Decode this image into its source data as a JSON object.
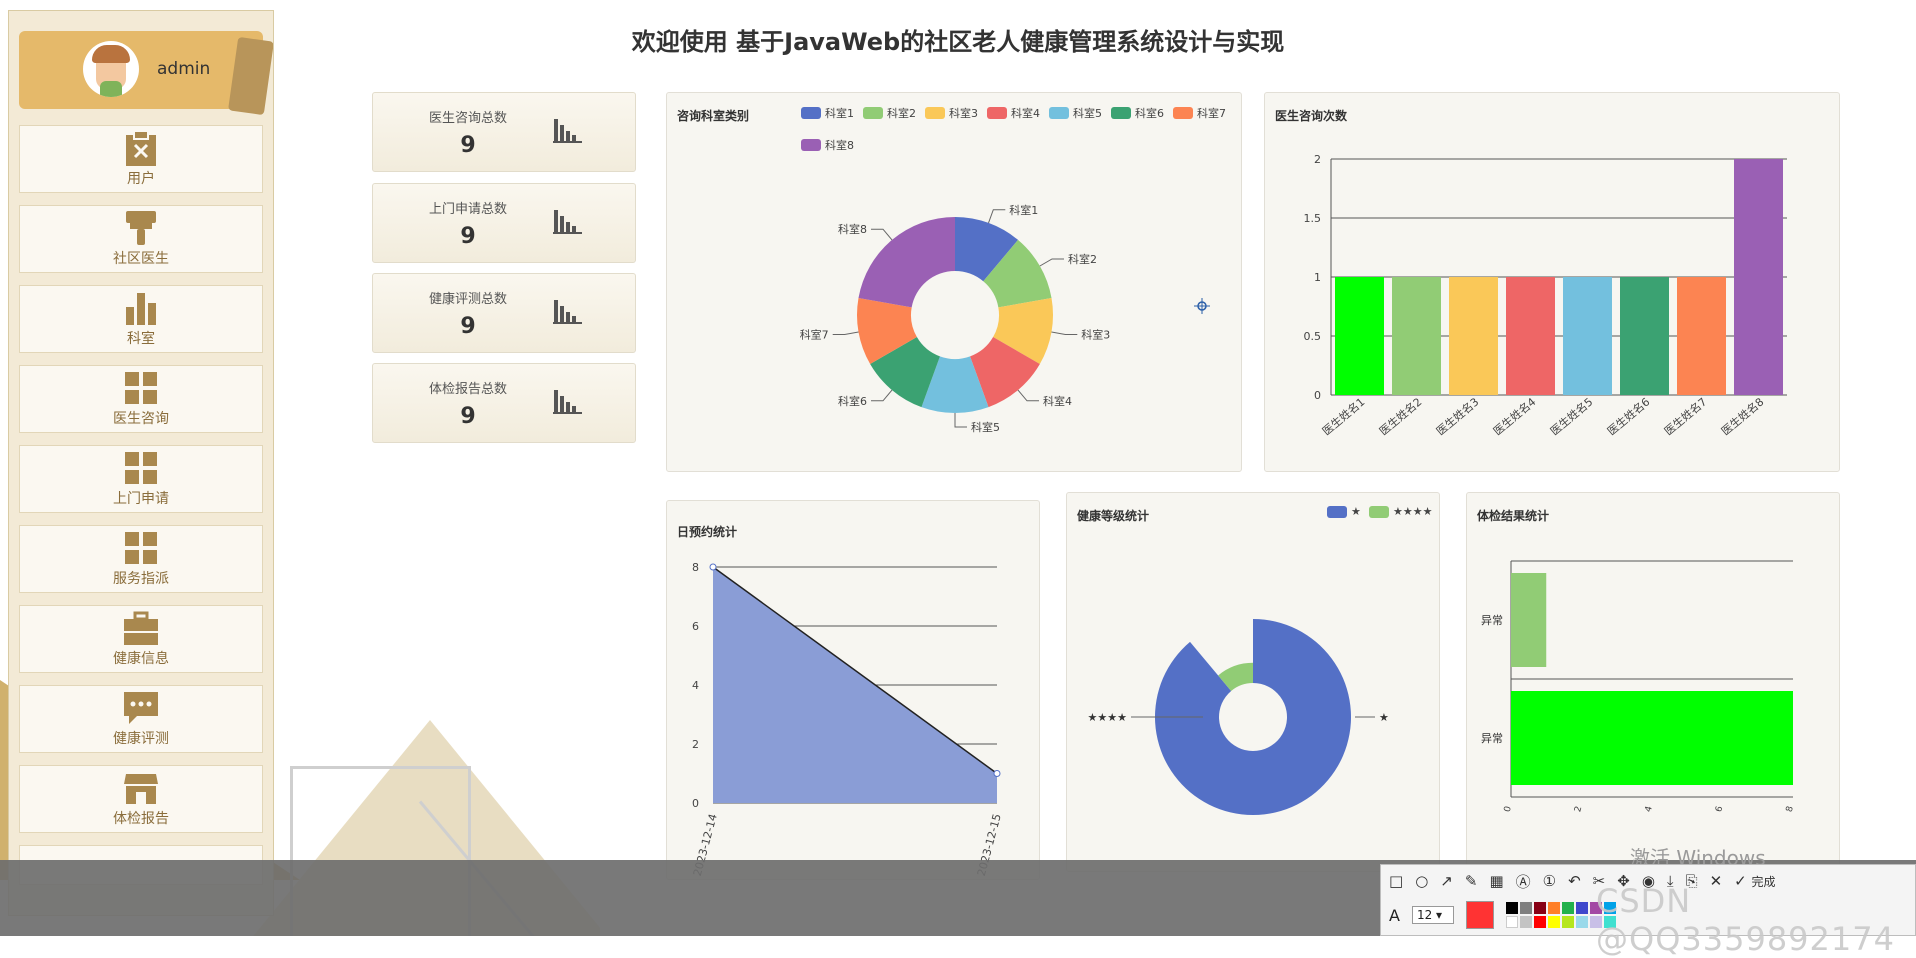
{
  "header": {
    "title": "欢迎使用 基于JavaWeb的社区老人健康管理系统设计与实现"
  },
  "user": {
    "name": "admin"
  },
  "sidebar": {
    "items": [
      {
        "label": "用户",
        "icon": "clipboard-x-icon"
      },
      {
        "label": "社区医生",
        "icon": "paint-roller-icon"
      },
      {
        "label": "科室",
        "icon": "bar-chart-icon"
      },
      {
        "label": "医生咨询",
        "icon": "grid-icon"
      },
      {
        "label": "上门申请",
        "icon": "grid-icon"
      },
      {
        "label": "服务指派",
        "icon": "grid-icon"
      },
      {
        "label": "健康信息",
        "icon": "briefcase-icon"
      },
      {
        "label": "健康评测",
        "icon": "chat-icon"
      },
      {
        "label": "体检报告",
        "icon": "store-icon"
      }
    ]
  },
  "stats": [
    {
      "label": "医生咨询总数",
      "value": "9"
    },
    {
      "label": "上门申请总数",
      "value": "9"
    },
    {
      "label": "健康评测总数",
      "value": "9"
    },
    {
      "label": "体检报告总数",
      "value": "9"
    }
  ],
  "colors": {
    "accent": "#e5b96a",
    "sidebar_bg": "#f3ead6",
    "text_gold": "#8a6d3b"
  },
  "chart_data": [
    {
      "type": "pie",
      "title": "咨询科室类别",
      "categories": [
        "科室1",
        "科室2",
        "科室3",
        "科室4",
        "科室5",
        "科室6",
        "科室7",
        "科室8"
      ],
      "values": [
        1,
        1,
        1,
        1,
        1,
        1,
        1,
        2
      ],
      "colors": [
        "#5470c6",
        "#91cc75",
        "#fac858",
        "#ee6666",
        "#73c0de",
        "#3ba272",
        "#fc8452",
        "#9a60b4"
      ],
      "legend": "top"
    },
    {
      "type": "bar",
      "title": "医生咨询次数",
      "categories": [
        "医生姓名1",
        "医生姓名2",
        "医生姓名3",
        "医生姓名4",
        "医生姓名5",
        "医生姓名6",
        "医生姓名7",
        "医生姓名8"
      ],
      "values": [
        1,
        1,
        1,
        1,
        1,
        1,
        1,
        2
      ],
      "colors": [
        "#00ff00",
        "#91cc75",
        "#fac858",
        "#ee6666",
        "#73c0de",
        "#3ba272",
        "#fc8452",
        "#9a60b4"
      ],
      "yticks": [
        "0",
        "0.5",
        "1",
        "1.5",
        "2"
      ],
      "ylim": [
        0,
        2
      ]
    },
    {
      "type": "area",
      "title": "日预约统计",
      "x": [
        "2023-12-14",
        "2023-12-15"
      ],
      "values": [
        8,
        1
      ],
      "yticks": [
        "0",
        "2",
        "4",
        "6",
        "8"
      ],
      "ylim": [
        0,
        8
      ],
      "color": "#8a9dd6"
    },
    {
      "type": "pie",
      "title": "健康等级统计",
      "categories": [
        "★",
        "★★★★"
      ],
      "values": [
        8,
        1
      ],
      "colors": [
        "#5470c6",
        "#91cc75"
      ],
      "legend": "top-right"
    },
    {
      "type": "bar",
      "title": "体检结果统计",
      "categories": [
        "异常",
        "异常"
      ],
      "values": [
        1,
        8
      ],
      "colors": [
        "#91cc75",
        "#00ff00"
      ],
      "orientation": "horizontal",
      "xticks": [
        "0",
        "2",
        "4",
        "6",
        "8"
      ],
      "xlim": [
        0,
        8
      ]
    }
  ],
  "overlay": {
    "watermark": "激活 Windows",
    "csdn": "CSDN @QQ3359892174",
    "toolbar": {
      "done_label": "完成",
      "font_size": "12",
      "font_label": "A"
    }
  }
}
